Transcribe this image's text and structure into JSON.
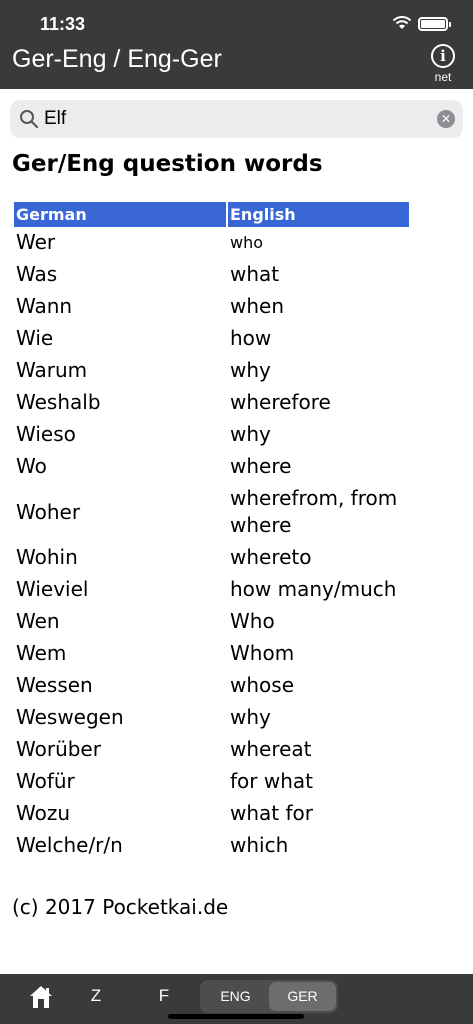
{
  "status": {
    "time": "11:33"
  },
  "nav": {
    "title": "Ger-Eng / Eng-Ger",
    "info_label": "net"
  },
  "search": {
    "value": "Elf",
    "placeholder": ""
  },
  "page": {
    "title": "Ger/Eng question words"
  },
  "table": {
    "headers": [
      "German",
      "English"
    ],
    "rows": [
      [
        "Wer",
        "who"
      ],
      [
        "Was",
        "what"
      ],
      [
        "Wann",
        "when"
      ],
      [
        "Wie",
        "how"
      ],
      [
        "Warum",
        "why"
      ],
      [
        "Weshalb",
        "wherefore"
      ],
      [
        "Wieso",
        "why"
      ],
      [
        "Wo",
        "where"
      ],
      [
        "Woher",
        "wherefrom, from where"
      ],
      [
        "Wohin",
        "whereto"
      ],
      [
        "Wieviel",
        "how many/much"
      ],
      [
        "Wen",
        "Who"
      ],
      [
        "Wem",
        "Whom"
      ],
      [
        "Wessen",
        "whose"
      ],
      [
        "Weswegen",
        "why"
      ],
      [
        "Worüber",
        "whereat"
      ],
      [
        "Wofür",
        "for what"
      ],
      [
        "Wozu",
        "what for"
      ],
      [
        "Welche/r/n",
        "which"
      ]
    ]
  },
  "footer": {
    "copyright": "(c) 2017 Pocketkai.de"
  },
  "tabbar": {
    "home_icon": "home-icon",
    "z_label": "Z",
    "f_label": "F",
    "eng_label": "ENG",
    "ger_label": "GER",
    "selected": "GER"
  },
  "colors": {
    "bar": "#3a3a3a",
    "header": "#3a67d6"
  }
}
